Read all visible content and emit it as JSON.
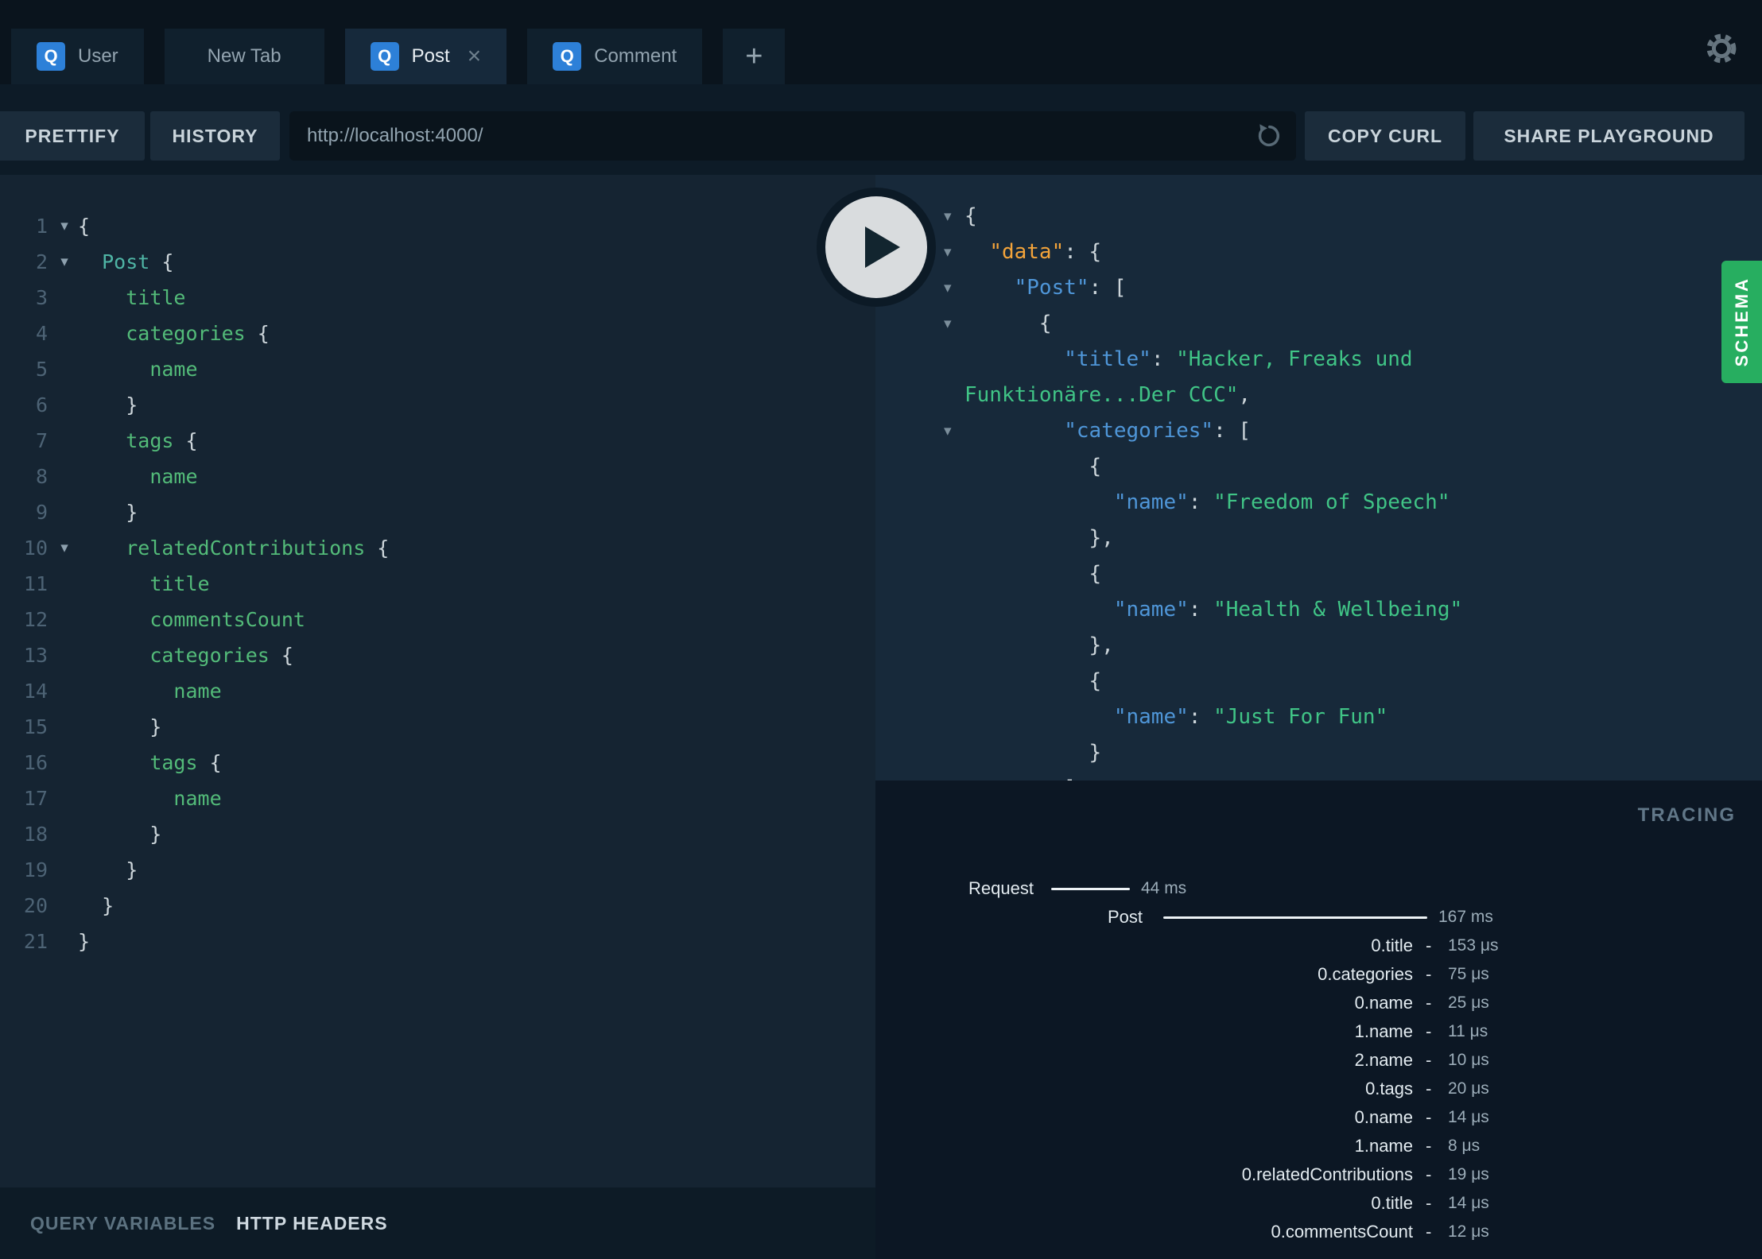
{
  "icons": {
    "fold_arrow": "▾",
    "collapse_arrow": "▾",
    "close_tab": "×",
    "add_tab": "+",
    "dash": "-",
    "gear": "settings-gear",
    "reload": "reload-circular-arrow",
    "play": "play-triangle"
  },
  "colors": {
    "accent_blue": "#2d80d8",
    "schema_green": "#27ae60",
    "field_green": "#53bb79",
    "json_key_blue": "#4f96d8",
    "json_data_orange": "#f4a43a",
    "json_string_green": "#40c486",
    "punctuation_gray": "#ccd5da"
  },
  "tabs": {
    "items": [
      {
        "icon": "Q",
        "label": "User",
        "active": false
      },
      {
        "icon": "",
        "label": "New Tab",
        "active": false
      },
      {
        "icon": "Q",
        "label": "Post",
        "active": true
      },
      {
        "icon": "Q",
        "label": "Comment",
        "active": false
      }
    ]
  },
  "toolbar": {
    "prettify_label": "PRETTIFY",
    "history_label": "HISTORY",
    "url_value": "http://localhost:4000/",
    "copy_curl_label": "COPY CURL",
    "share_label": "SHARE PLAYGROUND"
  },
  "schema_tab_label": "SCHEMA",
  "editor": {
    "lines": [
      {
        "n": 1,
        "fold": true,
        "code": [
          [
            "p",
            "{"
          ]
        ]
      },
      {
        "n": 2,
        "fold": true,
        "code": [
          [
            "p",
            "  "
          ],
          [
            "t",
            "Post"
          ],
          [
            "p",
            " {"
          ]
        ]
      },
      {
        "n": 3,
        "fold": false,
        "code": [
          [
            "p",
            "    "
          ],
          [
            "f",
            "title"
          ]
        ]
      },
      {
        "n": 4,
        "fold": false,
        "code": [
          [
            "p",
            "    "
          ],
          [
            "f",
            "categories"
          ],
          [
            "p",
            " {"
          ]
        ]
      },
      {
        "n": 5,
        "fold": false,
        "code": [
          [
            "p",
            "      "
          ],
          [
            "f",
            "name"
          ]
        ]
      },
      {
        "n": 6,
        "fold": false,
        "code": [
          [
            "p",
            "    }"
          ]
        ]
      },
      {
        "n": 7,
        "fold": false,
        "code": [
          [
            "p",
            "    "
          ],
          [
            "f",
            "tags"
          ],
          [
            "p",
            " {"
          ]
        ]
      },
      {
        "n": 8,
        "fold": false,
        "code": [
          [
            "p",
            "      "
          ],
          [
            "f",
            "name"
          ]
        ]
      },
      {
        "n": 9,
        "fold": false,
        "code": [
          [
            "p",
            "    }"
          ]
        ]
      },
      {
        "n": 10,
        "fold": true,
        "code": [
          [
            "p",
            "    "
          ],
          [
            "f",
            "relatedContributions"
          ],
          [
            "p",
            " {"
          ]
        ]
      },
      {
        "n": 11,
        "fold": false,
        "code": [
          [
            "p",
            "      "
          ],
          [
            "f",
            "title"
          ]
        ]
      },
      {
        "n": 12,
        "fold": false,
        "code": [
          [
            "p",
            "      "
          ],
          [
            "f",
            "commentsCount"
          ]
        ]
      },
      {
        "n": 13,
        "fold": false,
        "code": [
          [
            "p",
            "      "
          ],
          [
            "f",
            "categories"
          ],
          [
            "p",
            " {"
          ]
        ]
      },
      {
        "n": 14,
        "fold": false,
        "code": [
          [
            "p",
            "        "
          ],
          [
            "f",
            "name"
          ]
        ]
      },
      {
        "n": 15,
        "fold": false,
        "code": [
          [
            "p",
            "      }"
          ]
        ]
      },
      {
        "n": 16,
        "fold": false,
        "code": [
          [
            "p",
            "      "
          ],
          [
            "f",
            "tags"
          ],
          [
            "p",
            " {"
          ]
        ]
      },
      {
        "n": 17,
        "fold": false,
        "code": [
          [
            "p",
            "        "
          ],
          [
            "f",
            "name"
          ]
        ]
      },
      {
        "n": 18,
        "fold": false,
        "code": [
          [
            "p",
            "      }"
          ]
        ]
      },
      {
        "n": 19,
        "fold": false,
        "code": [
          [
            "p",
            "    }"
          ]
        ]
      },
      {
        "n": 20,
        "fold": false,
        "code": [
          [
            "p",
            "  }"
          ]
        ]
      },
      {
        "n": 21,
        "fold": false,
        "code": [
          [
            "p",
            "}"
          ]
        ]
      }
    ]
  },
  "result": {
    "lines": [
      {
        "arrow": true,
        "parts": [
          [
            "p",
            "{"
          ]
        ]
      },
      {
        "arrow": true,
        "parts": [
          [
            "p",
            "  "
          ],
          [
            "kd",
            "\"data\""
          ],
          [
            "p",
            ": {"
          ]
        ]
      },
      {
        "arrow": true,
        "parts": [
          [
            "p",
            "    "
          ],
          [
            "k",
            "\"Post\""
          ],
          [
            "p",
            ": ["
          ]
        ]
      },
      {
        "arrow": true,
        "parts": [
          [
            "p",
            "      {"
          ]
        ]
      },
      {
        "arrow": false,
        "parts": [
          [
            "p",
            "        "
          ],
          [
            "k",
            "\"title\""
          ],
          [
            "p",
            ": "
          ],
          [
            "s",
            "\"Hacker, Freaks und"
          ]
        ]
      },
      {
        "arrow": false,
        "parts": [
          [
            "s",
            "Funktionäre...Der CCC\""
          ],
          [
            "p",
            ","
          ]
        ]
      },
      {
        "arrow": true,
        "parts": [
          [
            "p",
            "        "
          ],
          [
            "k",
            "\"categories\""
          ],
          [
            "p",
            ": ["
          ]
        ]
      },
      {
        "arrow": false,
        "parts": [
          [
            "p",
            "          {"
          ]
        ]
      },
      {
        "arrow": false,
        "parts": [
          [
            "p",
            "            "
          ],
          [
            "k",
            "\"name\""
          ],
          [
            "p",
            ": "
          ],
          [
            "s",
            "\"Freedom of Speech\""
          ]
        ]
      },
      {
        "arrow": false,
        "parts": [
          [
            "p",
            "          },"
          ]
        ]
      },
      {
        "arrow": false,
        "parts": [
          [
            "p",
            "          {"
          ]
        ]
      },
      {
        "arrow": false,
        "parts": [
          [
            "p",
            "            "
          ],
          [
            "k",
            "\"name\""
          ],
          [
            "p",
            ": "
          ],
          [
            "s",
            "\"Health & Wellbeing\""
          ]
        ]
      },
      {
        "arrow": false,
        "parts": [
          [
            "p",
            "          },"
          ]
        ]
      },
      {
        "arrow": false,
        "parts": [
          [
            "p",
            "          {"
          ]
        ]
      },
      {
        "arrow": false,
        "parts": [
          [
            "p",
            "            "
          ],
          [
            "k",
            "\"name\""
          ],
          [
            "p",
            ": "
          ],
          [
            "s",
            "\"Just For Fun\""
          ]
        ]
      },
      {
        "arrow": false,
        "parts": [
          [
            "p",
            "          }"
          ]
        ]
      },
      {
        "arrow": false,
        "parts": [
          [
            "p",
            "        ]"
          ]
        ]
      }
    ]
  },
  "response_data": {
    "data": {
      "Post": [
        {
          "title": "Hacker, Freaks und Funktionäre...Der CCC",
          "categories": [
            {
              "name": "Freedom of Speech"
            },
            {
              "name": "Health & Wellbeing"
            },
            {
              "name": "Just For Fun"
            }
          ]
        }
      ]
    }
  },
  "tracing": {
    "title": "TRACING",
    "rows": [
      {
        "label": "Request",
        "lw": 199,
        "gap": 22,
        "bar": 99,
        "value": "44 ms"
      },
      {
        "label": "Post",
        "lw": 336,
        "gap": 26,
        "bar": 332,
        "value": "167 ms"
      },
      {
        "label": "0.title",
        "lw": 676,
        "value": "153 μs"
      },
      {
        "label": "0.categories",
        "lw": 676,
        "value": "75 μs"
      },
      {
        "label": "0.name",
        "lw": 676,
        "value": "25 μs"
      },
      {
        "label": "1.name",
        "lw": 676,
        "value": "11 μs"
      },
      {
        "label": "2.name",
        "lw": 676,
        "value": "10 μs"
      },
      {
        "label": "0.tags",
        "lw": 676,
        "value": "20 μs"
      },
      {
        "label": "0.name",
        "lw": 676,
        "value": "14 μs"
      },
      {
        "label": "1.name",
        "lw": 676,
        "value": "8 μs"
      },
      {
        "label": "0.relatedContributions",
        "lw": 676,
        "value": "19 μs"
      },
      {
        "label": "0.title",
        "lw": 676,
        "value": "14 μs"
      },
      {
        "label": "0.commentsCount",
        "lw": 676,
        "value": "12 μs"
      }
    ]
  },
  "footer": {
    "query_variables_label": "QUERY VARIABLES",
    "http_headers_label": "HTTP HEADERS"
  }
}
